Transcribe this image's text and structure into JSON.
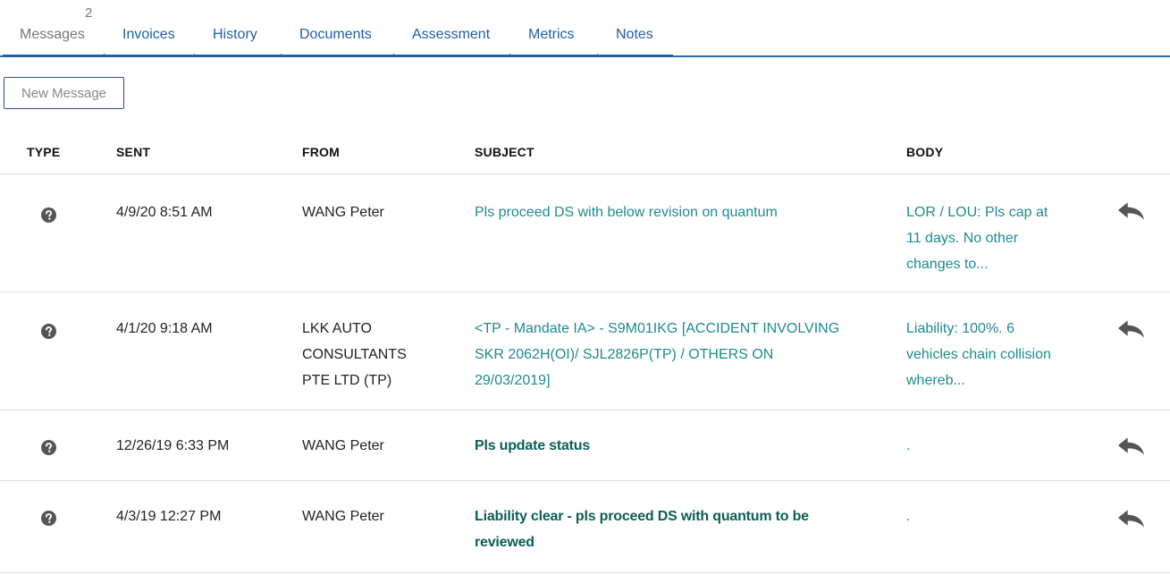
{
  "tabs": {
    "messages": {
      "label": "Messages",
      "badge": "2"
    },
    "invoices": {
      "label": "Invoices"
    },
    "history": {
      "label": "History"
    },
    "documents": {
      "label": "Documents"
    },
    "assessment": {
      "label": "Assessment"
    },
    "metrics": {
      "label": "Metrics"
    },
    "notes": {
      "label": "Notes"
    }
  },
  "toolbar": {
    "new_message_label": "New Message"
  },
  "table": {
    "headers": {
      "type": "TYPE",
      "sent": "SENT",
      "from": "FROM",
      "subject": "SUBJECT",
      "body": "BODY"
    },
    "rows": [
      {
        "type_icon": "question-circle-icon",
        "sent": "4/9/20 8:51 AM",
        "from": [
          "WANG Peter"
        ],
        "subject": [
          "Pls proceed DS with below revision on quantum"
        ],
        "subject_bold": false,
        "body": [
          "LOR / LOU: Pls cap at",
          "11 days. No other",
          "changes to..."
        ],
        "reply_icon": "reply-icon"
      },
      {
        "type_icon": "question-circle-icon",
        "sent": "4/1/20 9:18 AM",
        "from": [
          "LKK AUTO",
          "CONSULTANTS",
          "PTE LTD (TP)"
        ],
        "subject": [
          "<TP - Mandate IA> - S9M01IKG [ACCIDENT INVOLVING",
          "SKR 2062H(OI)/ SJL2826P(TP) / OTHERS ON",
          "29/03/2019]"
        ],
        "subject_bold": false,
        "body": [
          "Liability: 100%. 6",
          "vehicles chain collision",
          "whereb..."
        ],
        "reply_icon": "reply-icon"
      },
      {
        "type_icon": "question-circle-icon",
        "sent": "12/26/19 6:33 PM",
        "from": [
          "WANG Peter"
        ],
        "subject": [
          "Pls update status"
        ],
        "subject_bold": true,
        "body": [
          "."
        ],
        "reply_icon": "reply-icon"
      },
      {
        "type_icon": "question-circle-icon",
        "sent": "4/3/19 12:27 PM",
        "from": [
          "WANG Peter"
        ],
        "subject": [
          "Liability clear - pls proceed DS with quantum to be",
          "reviewed"
        ],
        "subject_bold": true,
        "body": [
          "."
        ],
        "reply_icon": "reply-icon"
      }
    ]
  },
  "colors": {
    "link": "#1f5fa8",
    "teal": "#1f8a8f",
    "dark_teal": "#0b5e57",
    "icon_gray": "#555555"
  }
}
